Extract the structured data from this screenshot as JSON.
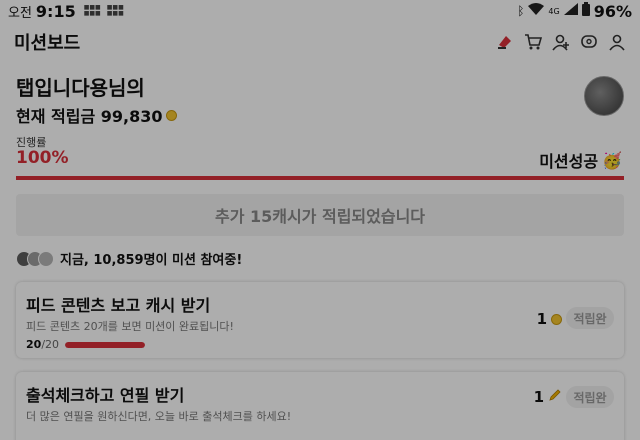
{
  "status_bar": {
    "ampm": "오전",
    "time": "9:15",
    "network_label": "4G",
    "battery": "96%"
  },
  "header": {
    "title": "미션보드",
    "icons": [
      "notification-icon",
      "cart-icon",
      "add-friend-icon",
      "chat-icon",
      "profile-icon"
    ]
  },
  "user": {
    "name": "탭입니다용님의",
    "points_label": "현재 적립금 99,830"
  },
  "progress": {
    "label": "진행률",
    "value": "100%",
    "fraction": 1.0,
    "done_label": "미션성공",
    "done_emoji": "🥳"
  },
  "banner": {
    "text": "추가 15캐시가 적립되었습니다"
  },
  "participants": {
    "text": "지금, 10,859명이 미션 참여중!"
  },
  "missions": [
    {
      "title": "피드 콘텐츠 보고 캐시 받기",
      "desc": "피드 콘텐츠 20개를 보면 미션이 완료됩니다!",
      "done": "20",
      "total": "/20",
      "progress_fraction": 1.0,
      "reward": "1",
      "reward_icon": "coin-icon",
      "status": "적립완"
    },
    {
      "title": "출석체크하고 연필 받기",
      "desc": "더 많은 연필을 원하신다면, 오늘 바로 출석체크를 하세요!",
      "reward": "1",
      "reward_icon": "pencil-icon",
      "status": "적립완"
    }
  ],
  "colors": {
    "accent": "#d9303a",
    "banner_bg": "#f2f2f2",
    "dim_overlay": "rgba(0,0,0,0.32)"
  }
}
